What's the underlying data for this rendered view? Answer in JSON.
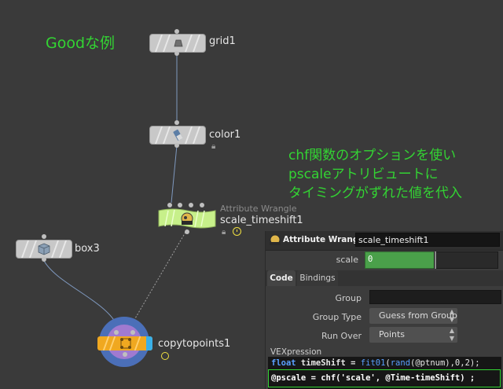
{
  "annotations": {
    "title": "Goodな例",
    "note_line1": "chf関数のオプションを使い",
    "note_line2": "pscaleアトリビュートに",
    "note_line3": "タイミングがずれた値を代入"
  },
  "nodes": {
    "grid": {
      "label": "grid1"
    },
    "color": {
      "label": "color1"
    },
    "wrangle": {
      "type_label": "Attribute Wrangle",
      "label": "scale_timeshift1"
    },
    "box": {
      "label": "box3"
    },
    "copy": {
      "label": "copytopoints1"
    }
  },
  "panel": {
    "header_type": "Attribute Wrangle",
    "node_name": "scale_timeshift1",
    "scale_label": "scale",
    "scale_value": "0",
    "tabs": [
      "Code",
      "Bindings"
    ],
    "group_label": "Group",
    "group_value": "",
    "group_type_label": "Group Type",
    "group_type_value": "Guess from Group",
    "run_over_label": "Run Over",
    "run_over_value": "Points",
    "vex_label": "VEXpression",
    "code_line1_kw": "float",
    "code_line1_var": " timeShift = ",
    "code_line1_fn": "fit01",
    "code_line1_p1": "(",
    "code_line1_fn2": "rand",
    "code_line1_rest": "(@ptnum),0,2);",
    "code_line2": "@pscale = chf('scale', @Time-timeShift) ;"
  },
  "colors": {
    "annotation": "#33d433",
    "wrangle_node": "#c7f08a",
    "scale_slider": "#4aa04a",
    "highlight_box": "#33d433"
  }
}
